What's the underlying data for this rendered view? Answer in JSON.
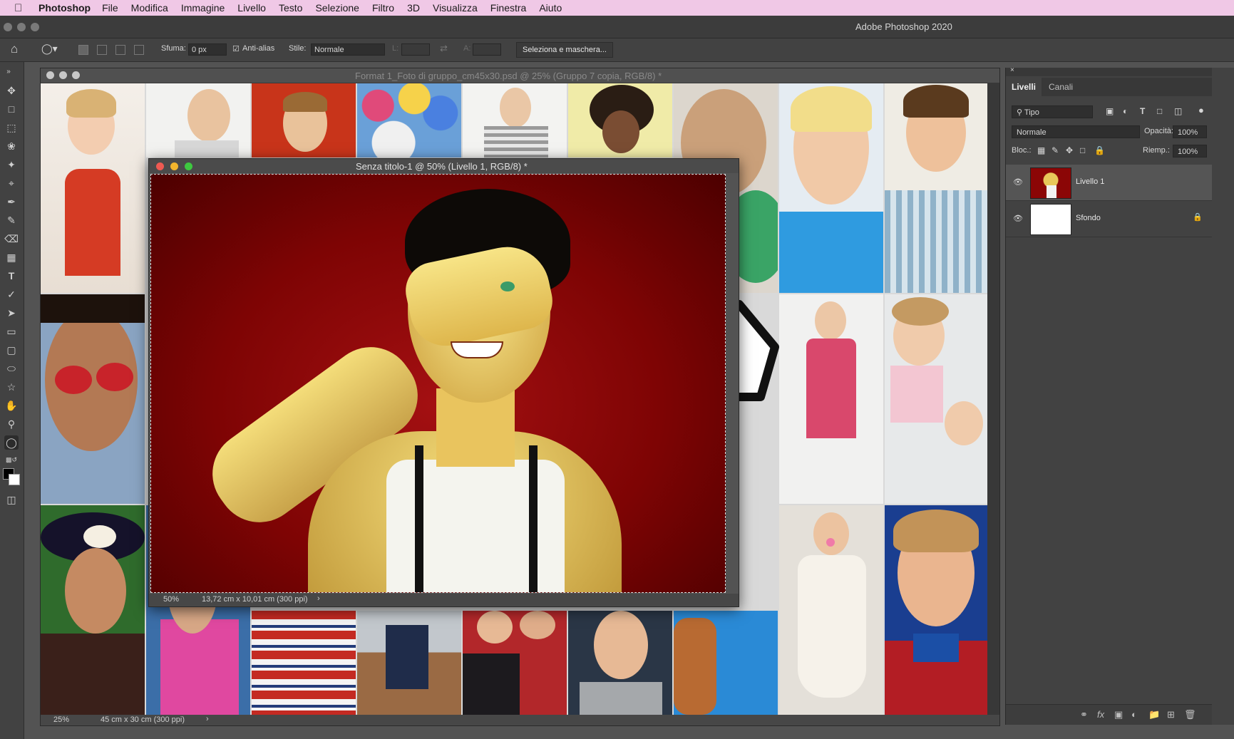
{
  "menubar": {
    "app": "Photoshop",
    "items": [
      "File",
      "Modifica",
      "Immagine",
      "Livello",
      "Testo",
      "Selezione",
      "Filtro",
      "3D",
      "Visualizza",
      "Finestra",
      "Aiuto"
    ]
  },
  "window": {
    "title": "Adobe Photoshop 2020"
  },
  "options": {
    "feather_label": "Sfuma:",
    "feather_value": "0 px",
    "antialias_label": "Anti-alias",
    "style_label": "Stile:",
    "style_value": "Normale",
    "width_label": "L:",
    "height_label": "A:",
    "mask_button": "Seleziona e maschera..."
  },
  "main_doc": {
    "title": "Format 1_Foto di gruppo_cm45x30.psd @ 25% (Gruppo 7 copia, RGB/8) *",
    "zoom": "25%",
    "size": "45 cm x 30 cm (300 ppi)"
  },
  "front_doc": {
    "title": "Senza titolo-1 @ 50% (Livello 1, RGB/8) *",
    "zoom": "50%",
    "size": "13,72 cm x 10,01 cm (300 ppi)"
  },
  "layers_panel": {
    "tabs": [
      "Livelli",
      "Canali"
    ],
    "filter": "Tipo",
    "blend_mode": "Normale",
    "opacity_label": "Opacità:",
    "opacity_value": "100%",
    "lock_label": "Bloc.:",
    "fill_label": "Riemp.:",
    "fill_value": "100%",
    "layers": [
      {
        "name": "Livello 1",
        "selected": true
      },
      {
        "name": "Sfondo",
        "locked": true
      }
    ]
  },
  "colors": {
    "menubar": "#f0c8e6",
    "background_red": "#8b0606",
    "panel": "#424242"
  }
}
